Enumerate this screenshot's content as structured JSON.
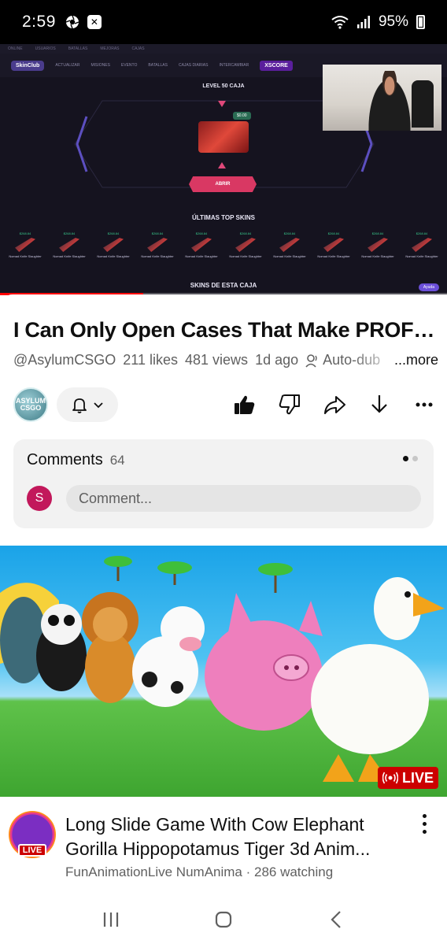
{
  "status_bar": {
    "time": "2:59",
    "battery": "95%",
    "left_icons": [
      "aperture-icon",
      "close-box-icon"
    ],
    "right_icons": [
      "wifi-icon",
      "signal-icon",
      "battery-icon"
    ]
  },
  "player": {
    "site": {
      "top_strip": [
        "ONLINE",
        "USUARIOS",
        "BATALLAS",
        "MEJORAS",
        "CAJAS"
      ],
      "logo": "SkinClub",
      "nav_items": [
        "ACTUALIZAR",
        "MISIONES",
        "EVENTO",
        "BATALLAS",
        "CAJAS DIARIAS",
        "INTERCAMBIAR"
      ],
      "xscore": "XSCORE",
      "level_title": "LEVEL 50 CAJA",
      "price": "$0.00",
      "open_button": "ABRIR",
      "top_skins_title": "ÚLTIMAS TOP SKINS",
      "case_skins_title": "SKINS DE ESTA CAJA",
      "help": "Ayuda",
      "skins": [
        {
          "price": "$268.84",
          "name": "Nomad Knife Slaughter"
        },
        {
          "price": "$268.84",
          "name": "Nomad Knife Slaughter"
        },
        {
          "price": "$268.84",
          "name": "Nomad Knife Slaughter"
        },
        {
          "price": "$268.84",
          "name": "Nomad Knife Slaughter"
        },
        {
          "price": "$268.84",
          "name": "Nomad Knife Slaughter"
        },
        {
          "price": "$268.84",
          "name": "Nomad Knife Slaughter"
        },
        {
          "price": "$268.84",
          "name": "Nomad Knife Slaughter"
        },
        {
          "price": "$268.84",
          "name": "Nomad Knife Slaughter"
        },
        {
          "price": "$268.84",
          "name": "Nomad Knife Slaughter"
        },
        {
          "price": "$268.84",
          "name": "Nomad Knife Slaughter"
        }
      ]
    },
    "progress_fraction": 0.32
  },
  "video": {
    "title": "I Can Only Open Cases That Make PROFIT...",
    "channel": "@AsylumCSGO",
    "likes": "211 likes",
    "views": "481 views",
    "age": "1d ago",
    "autodub": "Auto-dub",
    "more": "...more",
    "channel_avatar_text": "ASYLUM CSGO"
  },
  "comments": {
    "label": "Comments",
    "count": "64",
    "user_initial": "S",
    "placeholder": "Comment..."
  },
  "recommended": {
    "live_badge": "LIVE",
    "title_line1": "Long Slide Game With Cow Elephant",
    "title_line2": "Gorilla Hippopotamus Tiger 3d Anim...",
    "avatar_live": "LIVE",
    "meta": "FunAnimationLive NumAnima · 286 watching"
  },
  "colors": {
    "live_red": "#cc0000",
    "progress_red": "#ff0000",
    "site_pink": "#d93863"
  }
}
